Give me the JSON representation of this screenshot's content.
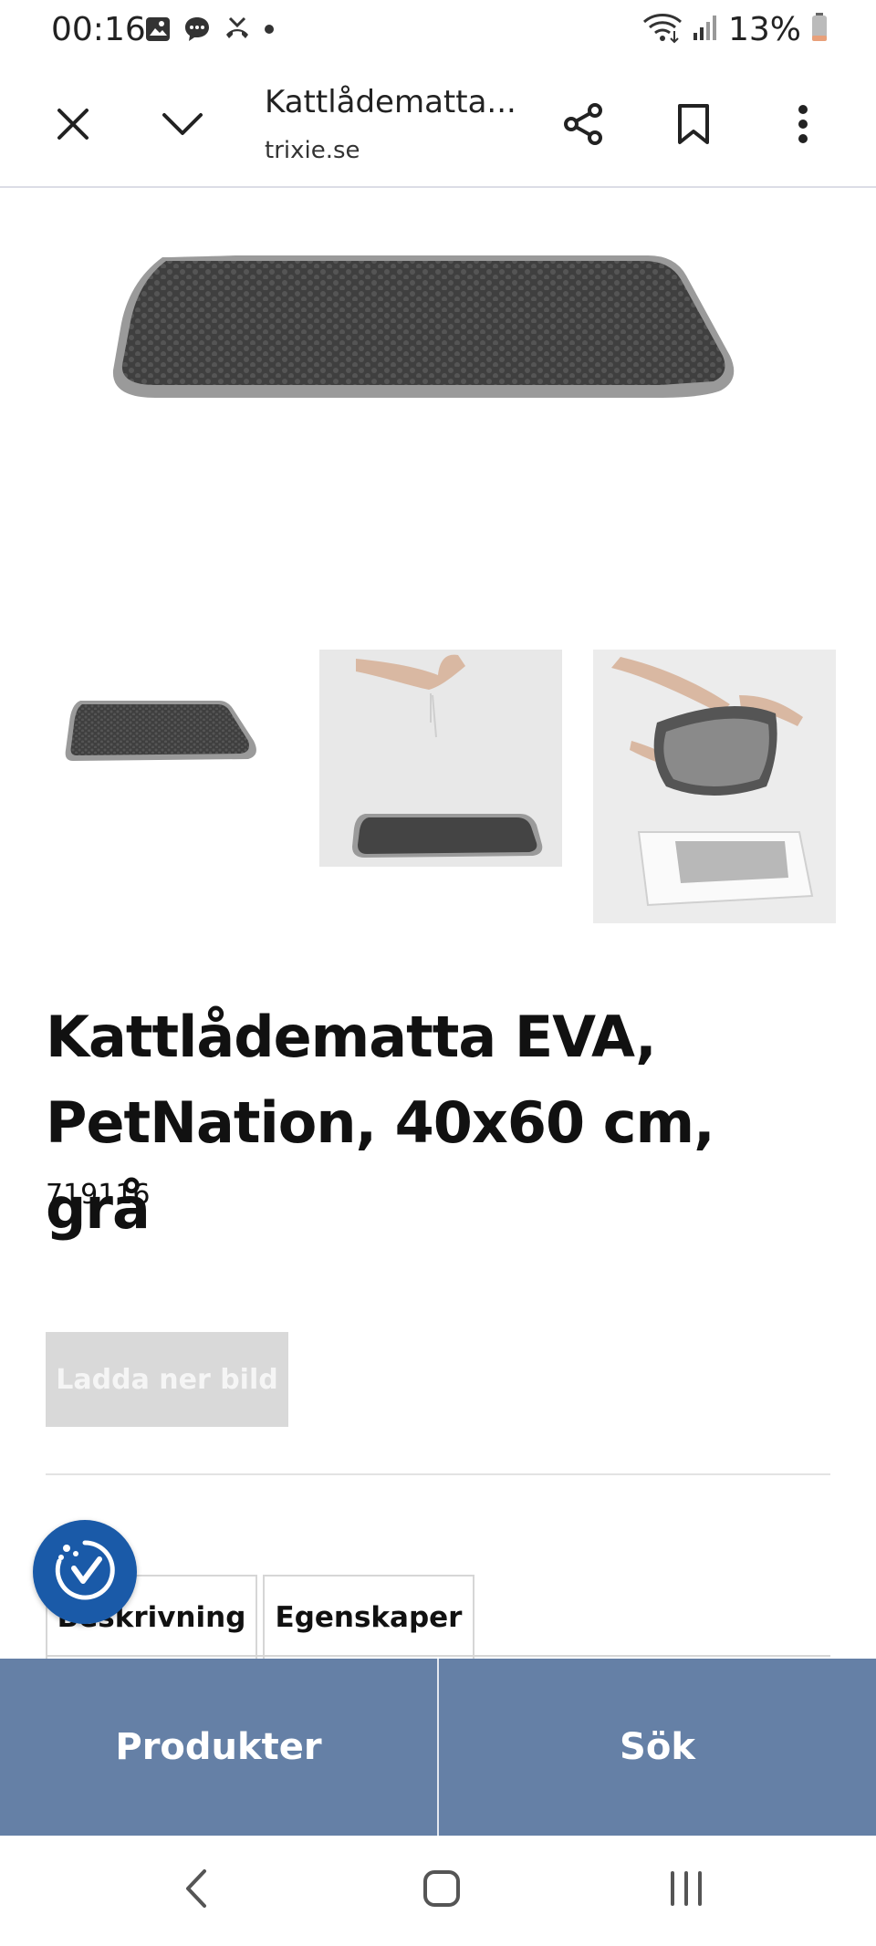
{
  "status_bar": {
    "time": "00:16",
    "battery_percent": "13%"
  },
  "toolbar": {
    "page_title": "Kattlådematta...",
    "domain": "trixie.se",
    "icons": [
      "close-icon",
      "chevron-down-icon",
      "share-icon",
      "bookmark-icon",
      "more-vert-icon"
    ]
  },
  "product": {
    "title": "Kattlådematta EVA, PetNation, 40x60 cm, grå",
    "sku": "719116",
    "download_label": "Ladda ner bild"
  },
  "tabs": [
    {
      "label": "Beskrivning"
    },
    {
      "label": "Egenskaper"
    }
  ],
  "bottom_nav": {
    "products_label": "Produkter",
    "search_label": "Sök"
  },
  "colors": {
    "bottom_nav_bg": "#6580a6",
    "accessibility_button": "#1a5aa8",
    "download_button_bg": "#d9d9d9"
  }
}
